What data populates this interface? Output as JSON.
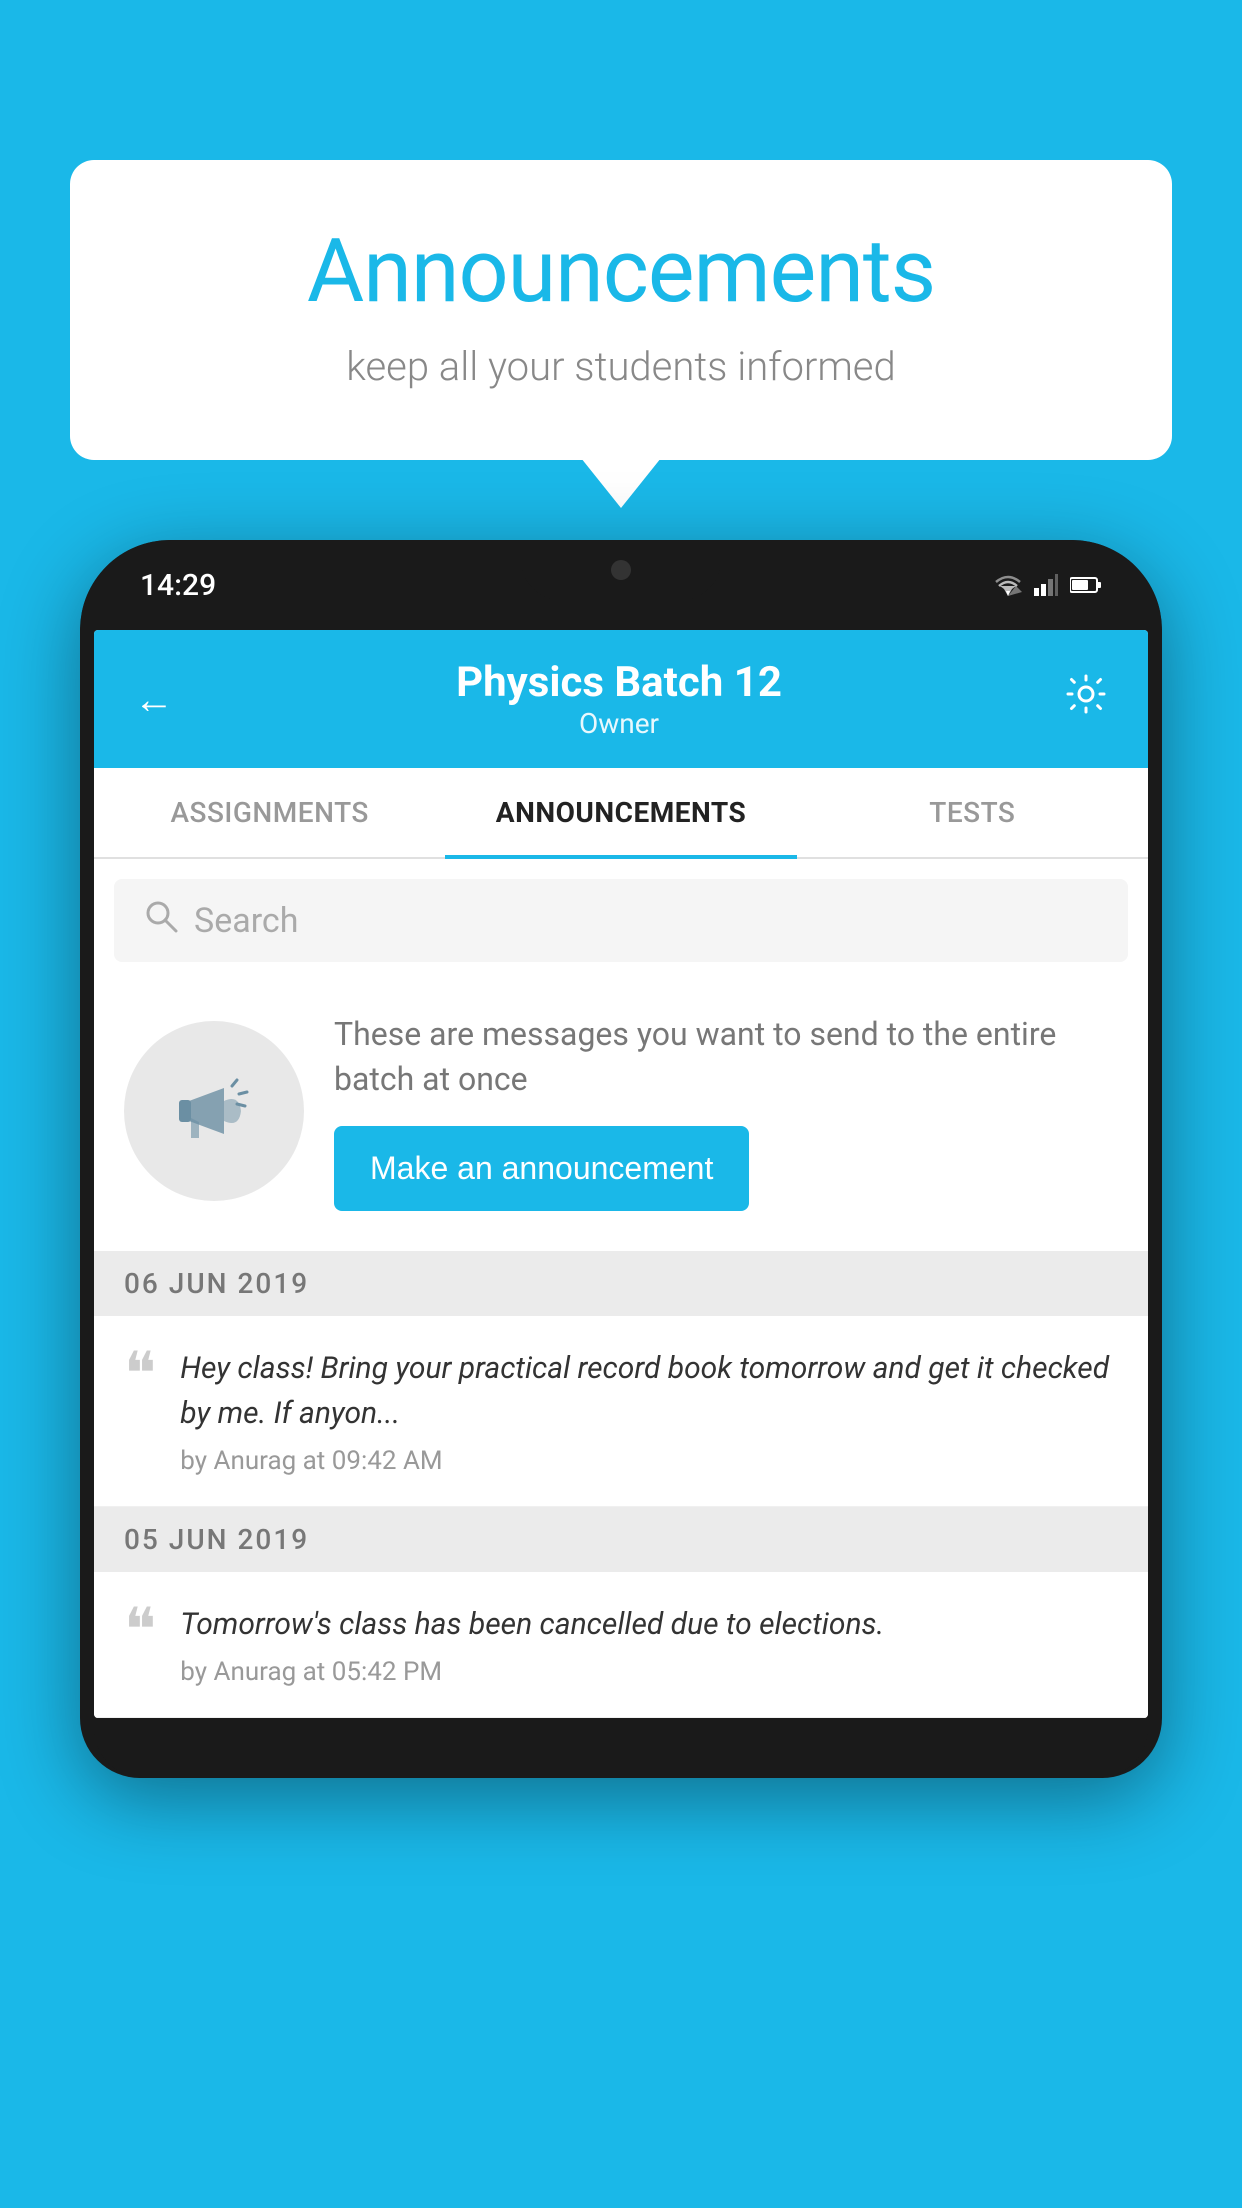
{
  "background_color": "#1ab8e8",
  "speech_bubble": {
    "title": "Announcements",
    "subtitle": "keep all your students informed"
  },
  "phone": {
    "status_bar": {
      "time": "14:29"
    },
    "header": {
      "title": "Physics Batch 12",
      "subtitle": "Owner",
      "back_label": "←"
    },
    "tabs": [
      {
        "label": "ASSIGNMENTS",
        "active": false
      },
      {
        "label": "ANNOUNCEMENTS",
        "active": true
      },
      {
        "label": "TESTS",
        "active": false
      }
    ],
    "search": {
      "placeholder": "Search"
    },
    "intro": {
      "description": "These are messages you want to send to the entire batch at once",
      "button_label": "Make an announcement"
    },
    "announcements": [
      {
        "date": "06  JUN  2019",
        "text": "Hey class! Bring your practical record book tomorrow and get it checked by me. If anyon...",
        "meta": "by Anurag at 09:42 AM"
      },
      {
        "date": "05  JUN  2019",
        "text": "Tomorrow's class has been cancelled due to elections.",
        "meta": "by Anurag at 05:42 PM"
      }
    ]
  }
}
